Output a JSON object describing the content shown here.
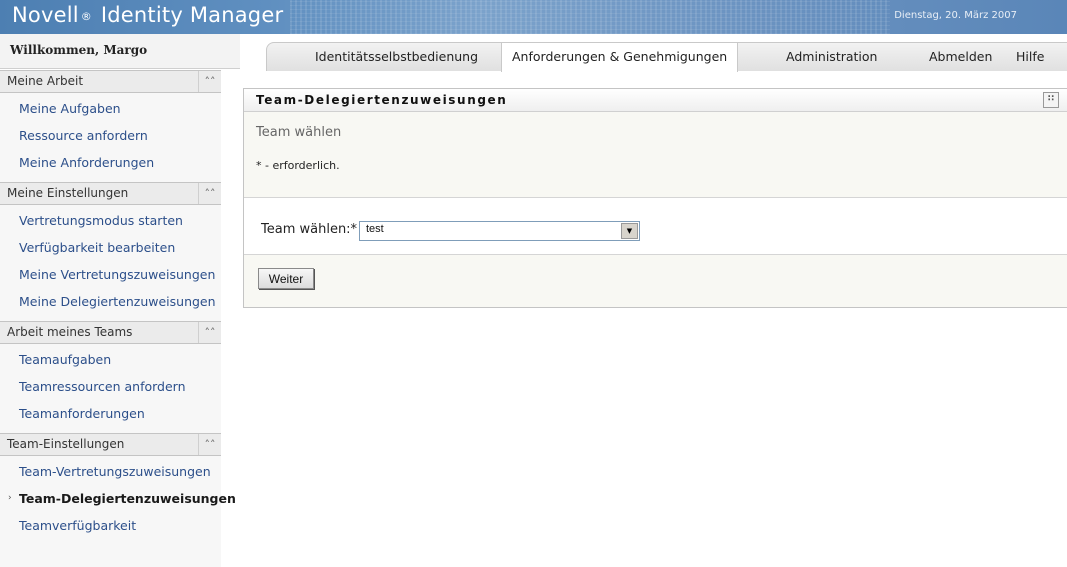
{
  "banner": {
    "brand": "Novell",
    "reg_mark": "®",
    "product": "Identity Manager",
    "date": "Dienstag, 20. März 2007"
  },
  "welcome": "Willkommen, Margo",
  "tabs": [
    {
      "label": "Identitätsselbstbedienung",
      "active": false
    },
    {
      "label": "Anforderungen & Genehmigungen",
      "active": true
    },
    {
      "label": "Administration",
      "active": false
    },
    {
      "label": "Abmelden",
      "active": false
    },
    {
      "label": "Hilfe",
      "active": false
    }
  ],
  "sidebar": {
    "sections": [
      {
        "title": "Meine Arbeit",
        "items": [
          "Meine Aufgaben",
          "Ressource anfordern",
          "Meine Anforderungen"
        ]
      },
      {
        "title": "Meine Einstellungen",
        "items": [
          "Vertretungsmodus starten",
          "Verfügbarkeit bearbeiten",
          "Meine Vertretungszuweisungen",
          "Meine Delegiertenzuweisungen"
        ]
      },
      {
        "title": "Arbeit meines Teams",
        "items": [
          "Teamaufgaben",
          "Teamressourcen anfordern",
          "Teamanforderungen"
        ]
      },
      {
        "title": "Team-Einstellungen",
        "items": [
          "Team-Vertretungszuweisungen",
          "Team-Delegiertenzuweisungen",
          "Teamverfügbarkeit"
        ]
      }
    ],
    "current_item": "Team-Delegiertenzuweisungen",
    "collapse_icon": "double-chevron-up-icon"
  },
  "panel": {
    "title": "Team-Delegiertenzuweisungen",
    "subtitle": "Team wählen",
    "required_note": "* - erforderlich.",
    "team_label": "Team wählen:*",
    "team_value": "test",
    "submit_label": "Weiter"
  }
}
